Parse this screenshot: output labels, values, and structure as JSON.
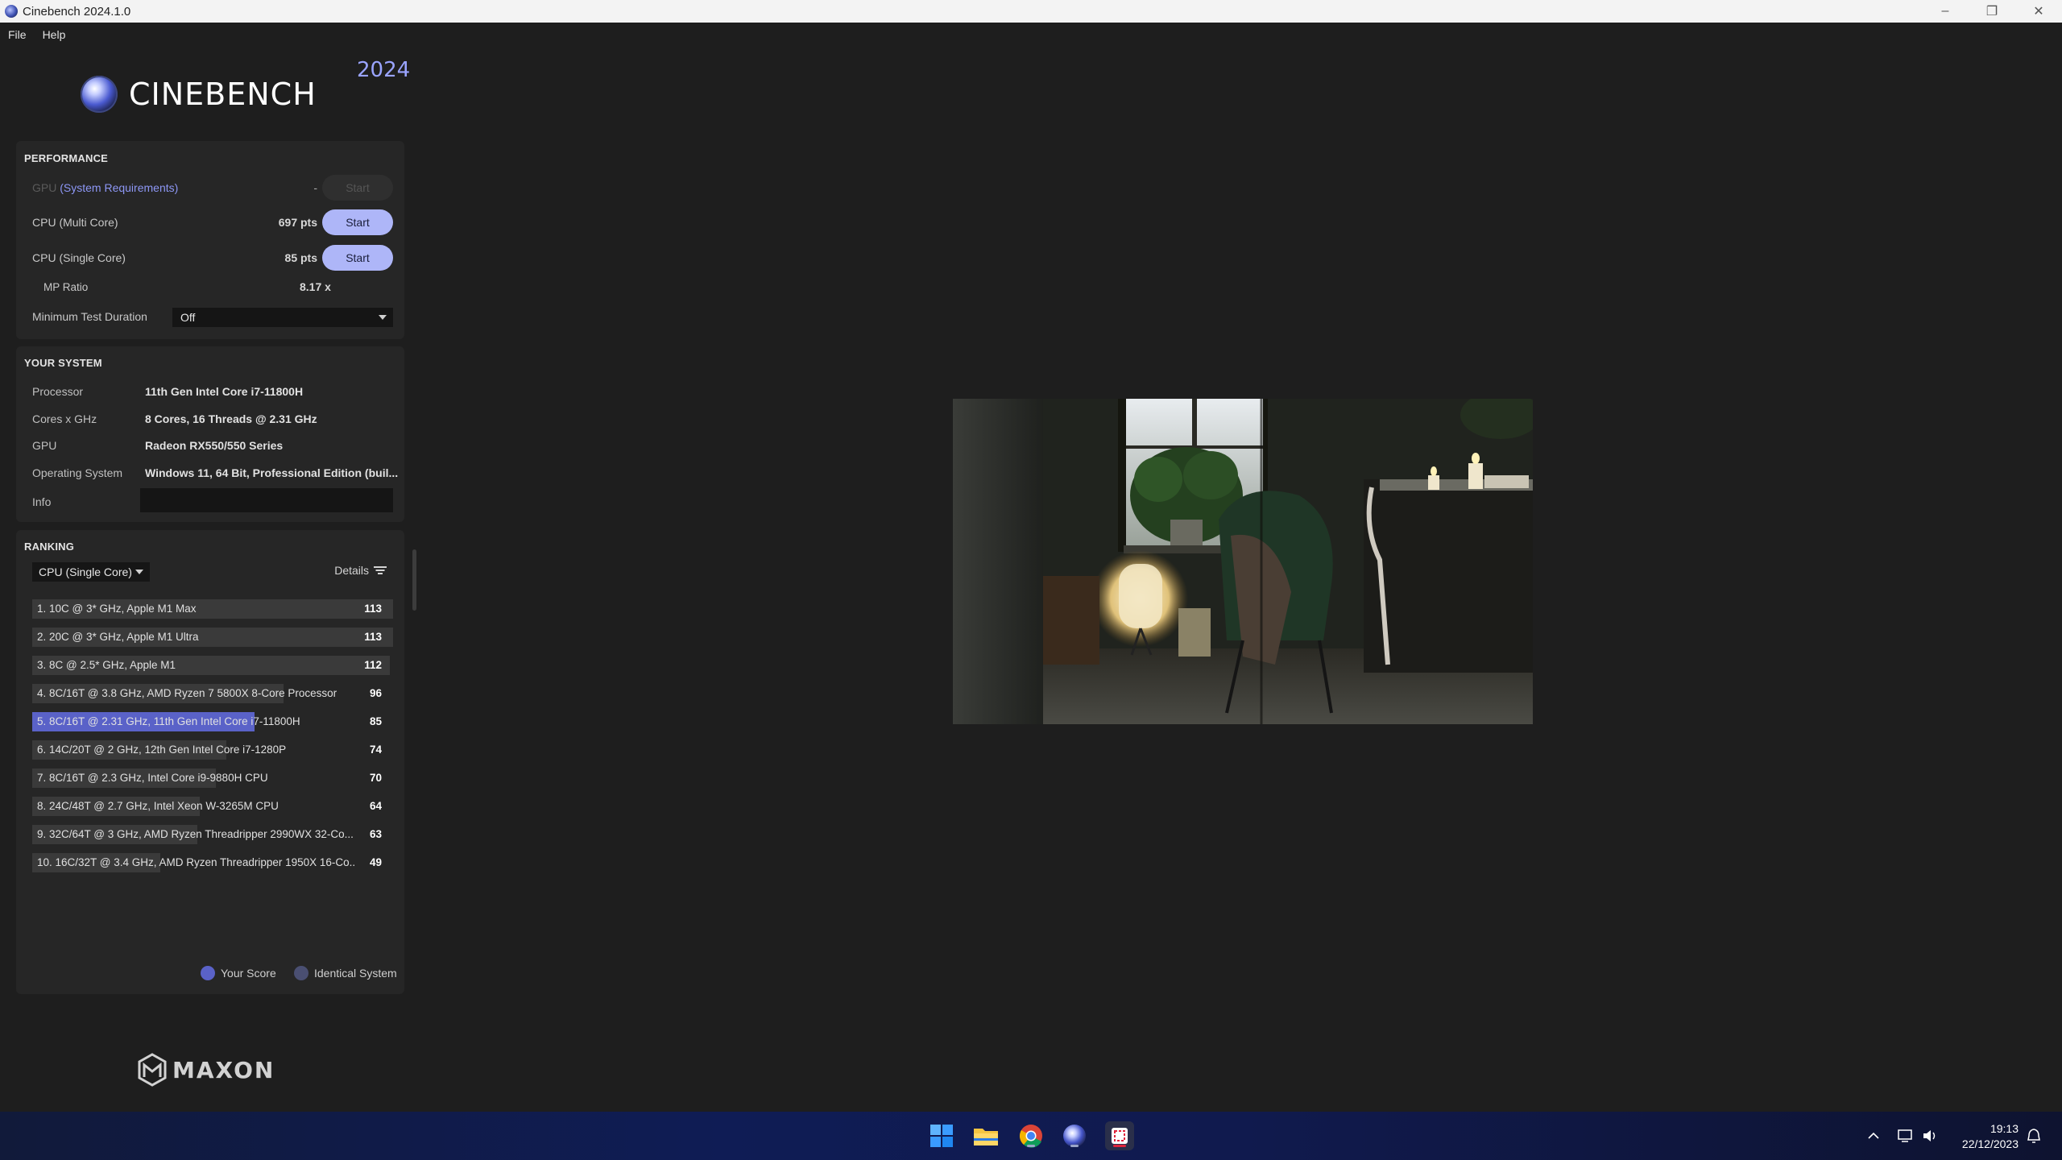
{
  "window": {
    "title": "Cinebench 2024.1.0"
  },
  "menu": {
    "file": "File",
    "help": "Help"
  },
  "brand": {
    "name": "CINEBENCH",
    "year": "2024",
    "footer": "MAXON"
  },
  "performance": {
    "title": "PERFORMANCE",
    "gpu_label": "GPU",
    "gpu_link": "(System Requirements)",
    "gpu_score": "-",
    "cpu_multi_label": "CPU (Multi Core)",
    "cpu_multi_score": "697 pts",
    "cpu_single_label": "CPU (Single Core)",
    "cpu_single_score": "85 pts",
    "mp_ratio_label": "MP Ratio",
    "mp_ratio_value": "8.17 x",
    "start_label": "Start",
    "min_duration_label": "Minimum Test Duration",
    "min_duration_value": "Off"
  },
  "system": {
    "title": "YOUR SYSTEM",
    "processor_label": "Processor",
    "processor_value": "11th Gen Intel Core i7-11800H",
    "cores_label": "Cores x GHz",
    "cores_value": "8 Cores, 16 Threads @ 2.31 GHz",
    "gpu_label": "GPU",
    "gpu_value": "Radeon RX550/550 Series",
    "os_label": "Operating System",
    "os_value": "Windows 11, 64 Bit, Professional Edition (buil...",
    "info_label": "Info",
    "info_value": ""
  },
  "ranking": {
    "title": "RANKING",
    "selected_test": "CPU (Single Core)",
    "details_label": "Details",
    "items": [
      {
        "label": "1. 10C @ 3* GHz, Apple M1 Max",
        "score": "113",
        "mine": false
      },
      {
        "label": "2. 20C @ 3* GHz, Apple M1 Ultra",
        "score": "113",
        "mine": false
      },
      {
        "label": "3. 8C @ 2.5* GHz, Apple M1",
        "score": "112",
        "mine": false
      },
      {
        "label": "4. 8C/16T @ 3.8 GHz, AMD Ryzen 7 5800X 8-Core Processor",
        "score": "96",
        "mine": false
      },
      {
        "label": "5. 8C/16T @ 2.31 GHz, 11th Gen Intel Core i7-11800H",
        "score": "85",
        "mine": true
      },
      {
        "label": "6. 14C/20T @ 2 GHz, 12th Gen Intel Core i7-1280P",
        "score": "74",
        "mine": false
      },
      {
        "label": "7. 8C/16T @ 2.3 GHz, Intel Core i9-9880H CPU",
        "score": "70",
        "mine": false
      },
      {
        "label": "8. 24C/48T @ 2.7 GHz, Intel Xeon W-3265M CPU",
        "score": "64",
        "mine": false
      },
      {
        "label": "9. 32C/64T @ 3 GHz, AMD Ryzen Threadripper 2990WX 32-Co...",
        "score": "63",
        "mine": false
      },
      {
        "label": "10. 16C/32T @ 3.4 GHz, AMD Ryzen Threadripper 1950X 16-Co...",
        "score": "49",
        "mine": false
      }
    ],
    "legend_your_score": "Your Score",
    "legend_identical": "Identical System",
    "colors": {
      "bar": "#3a3a3a",
      "mine": "#5a62c8",
      "your_score_dot": "#5a62c8",
      "identical_dot": "#4a4f72"
    }
  },
  "taskbar": {
    "time": "19:13",
    "date": "22/12/2023",
    "apps": [
      "windows-start-icon",
      "file-explorer-icon",
      "chrome-icon",
      "cinebench-icon",
      "snipping-tool-icon"
    ]
  },
  "colors": {
    "accent": "#aeb6f8",
    "link": "#8d97f5",
    "panel": "#262626",
    "background": "#1e1e1e"
  }
}
